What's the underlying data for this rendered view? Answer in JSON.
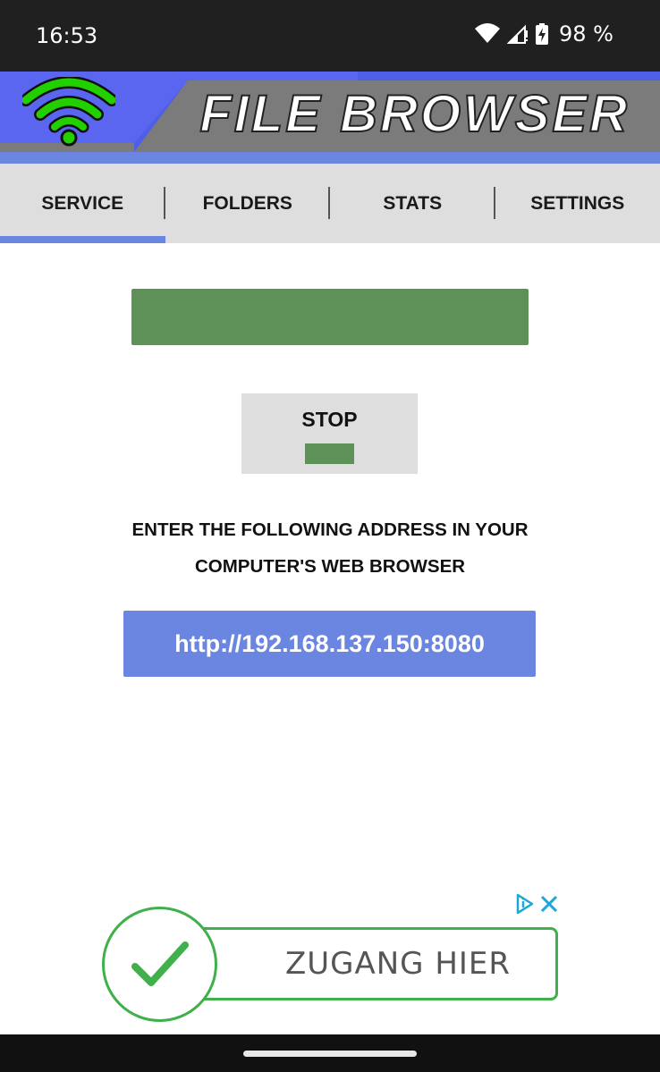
{
  "status_bar": {
    "time": "16:53",
    "battery": "98 %",
    "icons": [
      "wifi-icon",
      "cell-signal-icon",
      "battery-charging-icon"
    ]
  },
  "banner": {
    "title": "FILE BROWSER",
    "logo_icon": "wifi-logo-icon",
    "colors": {
      "primary": "#6b86e0",
      "panel": "#7b7b7b",
      "logo": "#22d000"
    }
  },
  "tabs": [
    {
      "label": "SERVICE",
      "active": true
    },
    {
      "label": "FOLDERS",
      "active": false
    },
    {
      "label": "STATS",
      "active": false
    },
    {
      "label": "SETTINGS",
      "active": false
    }
  ],
  "service": {
    "status_color": "#5d9158",
    "stop_label": "STOP",
    "instruction": "ENTER THE FOLLOWING ADDRESS IN YOUR COMPUTER'S WEB BROWSER",
    "address": "http://192.168.137.150:8080"
  },
  "ad": {
    "text": "ZUGANG HIER",
    "accent": "#3fb04a",
    "icons": [
      "adchoices-icon",
      "close-icon",
      "checkmark-icon"
    ]
  }
}
